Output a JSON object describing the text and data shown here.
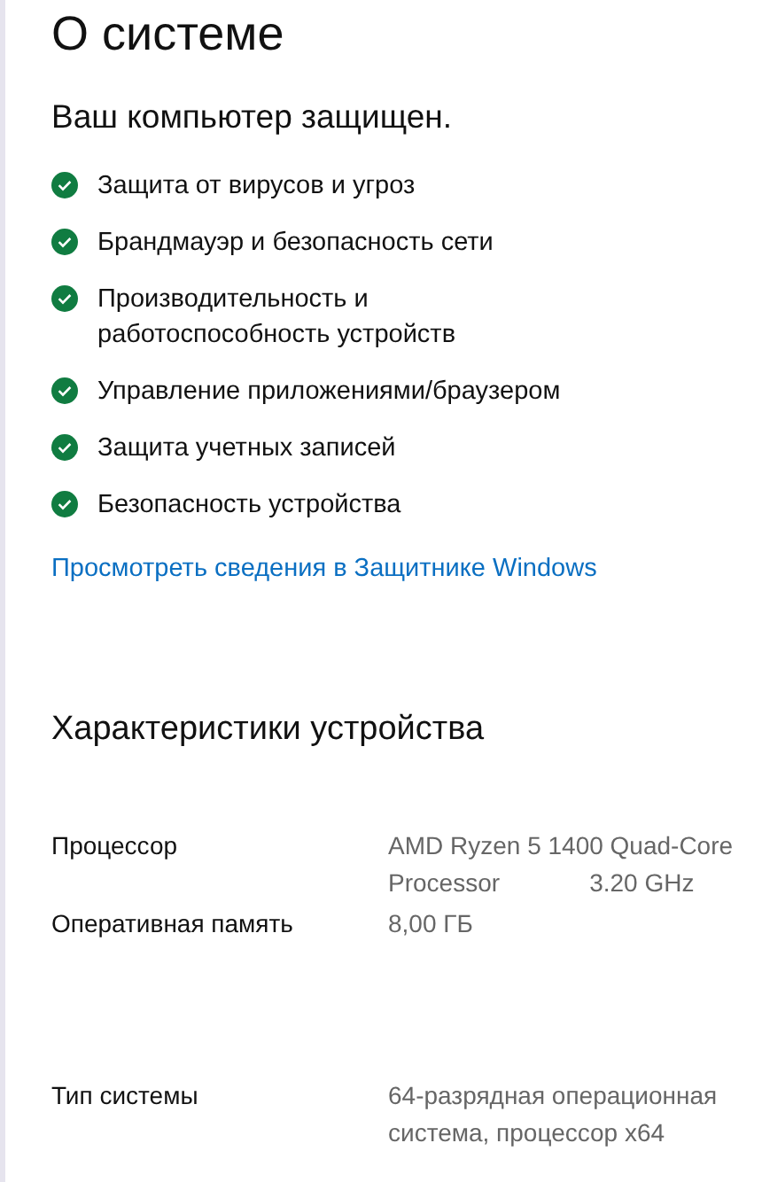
{
  "title": "О системе",
  "protection": {
    "heading": "Ваш компьютер защищен.",
    "items": [
      {
        "label": "Защита от вирусов и угроз",
        "protected": true
      },
      {
        "label": "Брандмауэр и безопасность сети",
        "protected": true
      },
      {
        "label": "Производительность и работоспособность устройств",
        "protected": true
      },
      {
        "label": "Управление приложениями/браузером",
        "protected": true
      },
      {
        "label": "Защита учетных записей",
        "protected": true
      },
      {
        "label": "Безопасность устройства",
        "protected": true
      }
    ],
    "link": "Просмотреть сведения в Защитнике Windows"
  },
  "specs": {
    "heading": "Характеристики устройства",
    "rows": [
      {
        "label": "Процессор",
        "value": "AMD Ryzen 5 1400 Quad-Core Processor             3.20 GHz"
      },
      {
        "label": "Оперативная память",
        "value": "8,00 ГБ"
      },
      {
        "label": "Тип системы",
        "value": "64-разрядная операционная система, процессор x64"
      }
    ]
  }
}
